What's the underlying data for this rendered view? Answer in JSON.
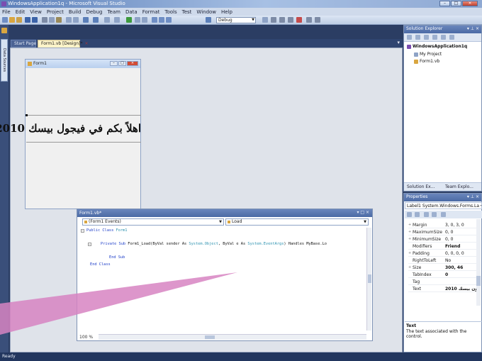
{
  "window": {
    "title": "WindowsApplication1q - Microsoft Visual Studio",
    "minimize_glyph": "–",
    "maximize_glyph": "□",
    "close_glyph": "×"
  },
  "menu": [
    "File",
    "Edit",
    "View",
    "Project",
    "Build",
    "Debug",
    "Team",
    "Data",
    "Format",
    "Tools",
    "Test",
    "Window",
    "Help"
  ],
  "toolbar": {
    "config": "Debug"
  },
  "toolbox": {
    "label": "Data Sources"
  },
  "doc_tabs": {
    "start_page": "Start Page",
    "form_design": "Form1.vb [Design]*",
    "close_glyph": "×",
    "pin_glyph": "▾"
  },
  "form1": {
    "title": "Form1",
    "label_text": "اهلاً بكم في فيجول بيسك 2010"
  },
  "code_window": {
    "title": "Form1.vb*",
    "buttons": "▾ □ ×",
    "class_combo": "(Form1 Events)",
    "method_combo": "Load",
    "zoom": "100 %",
    "lines": {
      "l1_kw": "Public Class",
      "l1_name": "Form1",
      "l2_kw1": "Private Sub",
      "l2_name": "Form1_Load(ByVal sender As",
      "l2_t1": "System.Object",
      "l2_mid": ", ByVal e As",
      "l2_t2": "System.EventArgs",
      "l2_tail": ") Handles MyBase.Lo",
      "l3": "End Sub",
      "l4": "End Class"
    }
  },
  "solution_explorer": {
    "title": "Solution Explorer",
    "pin": "▾ ⊥ ×",
    "items": [
      "WindowsApplication1q",
      "My Project",
      "Form1.vb"
    ],
    "tab_solution": "Solution Ex...",
    "tab_team": "Team Explo..."
  },
  "properties": {
    "title": "Properties",
    "pin": "▾ ⊥ ×",
    "object": "Label1 System.Windows.Forms.La ▾",
    "rows": [
      {
        "name": "Margin",
        "value": "3, 0, 3, 0",
        "expander": "+"
      },
      {
        "name": "MaximumSize",
        "value": "0, 0",
        "expander": "+"
      },
      {
        "name": "MinimumSize",
        "value": "0, 0",
        "expander": "+"
      },
      {
        "name": "Modifiers",
        "value": "Friend",
        "expander": ""
      },
      {
        "name": "Padding",
        "value": "0, 0, 0, 0",
        "expander": "+"
      },
      {
        "name": "RightToLeft",
        "value": "No",
        "expander": ""
      },
      {
        "name": "Size",
        "value": "300, 46",
        "expander": "+"
      },
      {
        "name": "TabIndex",
        "value": "0",
        "expander": ""
      },
      {
        "name": "Tag",
        "value": "",
        "expander": ""
      },
      {
        "name": "Text",
        "value": "ون بيسك 2010",
        "expander": ""
      }
    ],
    "desc_title": "Text",
    "desc_body": "The text associated with the control."
  },
  "status": {
    "text": "Ready"
  }
}
